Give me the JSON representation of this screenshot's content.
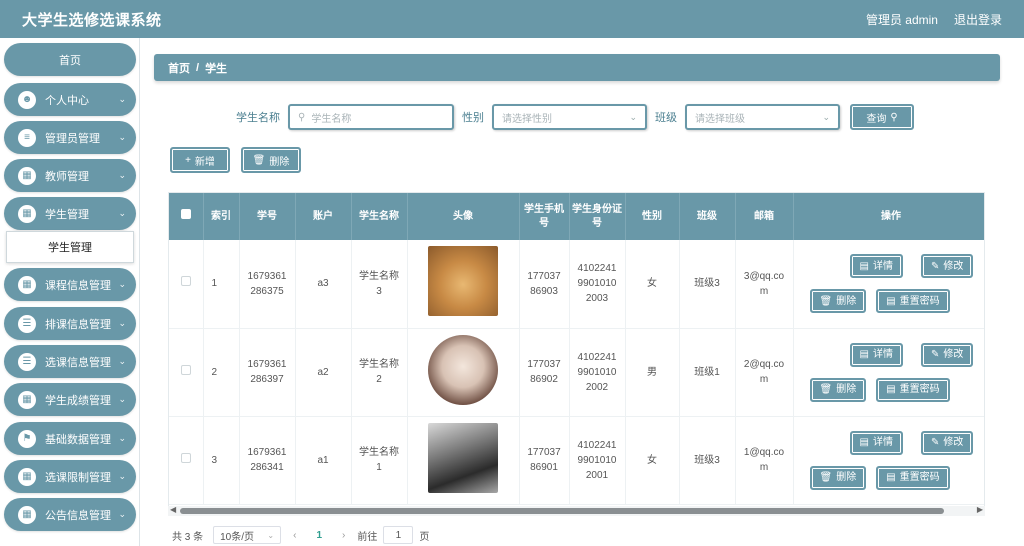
{
  "header": {
    "title": "大学生选修选课系统",
    "user": "管理员 admin",
    "logout": "退出登录"
  },
  "sidebar": {
    "home": "首页",
    "items": [
      {
        "label": "个人中心",
        "icon": "user-icon"
      },
      {
        "label": "管理员管理",
        "icon": "sliders-icon"
      },
      {
        "label": "教师管理",
        "icon": "grid-icon"
      },
      {
        "label": "学生管理",
        "icon": "grid-icon"
      },
      {
        "label": "课程信息管理",
        "icon": "grid-icon"
      },
      {
        "label": "排课信息管理",
        "icon": "list-icon"
      },
      {
        "label": "选课信息管理",
        "icon": "list-icon"
      },
      {
        "label": "学生成绩管理",
        "icon": "grid-icon"
      },
      {
        "label": "基础数据管理",
        "icon": "flag-icon"
      },
      {
        "label": "选课限制管理",
        "icon": "grid-icon"
      },
      {
        "label": "公告信息管理",
        "icon": "grid-icon"
      }
    ],
    "sub_active": "学生管理"
  },
  "breadcrumb": {
    "home": "首页",
    "sep": "/",
    "current": "学生"
  },
  "search": {
    "name_label": "学生名称",
    "name_placeholder": "学生名称",
    "gender_label": "性别",
    "gender_placeholder": "请选择性别",
    "class_label": "班级",
    "class_placeholder": "请选择班级",
    "query_button": "查询"
  },
  "actions": {
    "add": "新增",
    "delete": "删除"
  },
  "table": {
    "headers": [
      "索引",
      "学号",
      "账户",
      "学生名称",
      "头像",
      "学生手机号",
      "学生身份证号",
      "性别",
      "班级",
      "邮箱",
      "操作"
    ],
    "rows": [
      {
        "index": "1",
        "sno": "1679361286375",
        "account": "a3",
        "name": "学生名称3",
        "phone": "17703786903",
        "idcard": "410224199010102003",
        "gender": "女",
        "class": "班级3",
        "email": "3@qq.com"
      },
      {
        "index": "2",
        "sno": "1679361286397",
        "account": "a2",
        "name": "学生名称2",
        "phone": "17703786902",
        "idcard": "410224199010102002",
        "gender": "男",
        "class": "班级1",
        "email": "2@qq.com"
      },
      {
        "index": "3",
        "sno": "1679361286341",
        "account": "a1",
        "name": "学生名称1",
        "phone": "17703786901",
        "idcard": "410224199010102001",
        "gender": "女",
        "class": "班级3",
        "email": "1@qq.com"
      }
    ],
    "ops": {
      "detail": "详情",
      "edit": "修改",
      "delete": "删除",
      "reset": "重置密码"
    }
  },
  "pager": {
    "total": "共 3 条",
    "size": "10条/页",
    "page": "1",
    "goto_label": "前往",
    "goto_value": "1",
    "page_unit": "页"
  },
  "colors": {
    "primary": "#6998a8",
    "active_page": "#2f9e8f"
  }
}
